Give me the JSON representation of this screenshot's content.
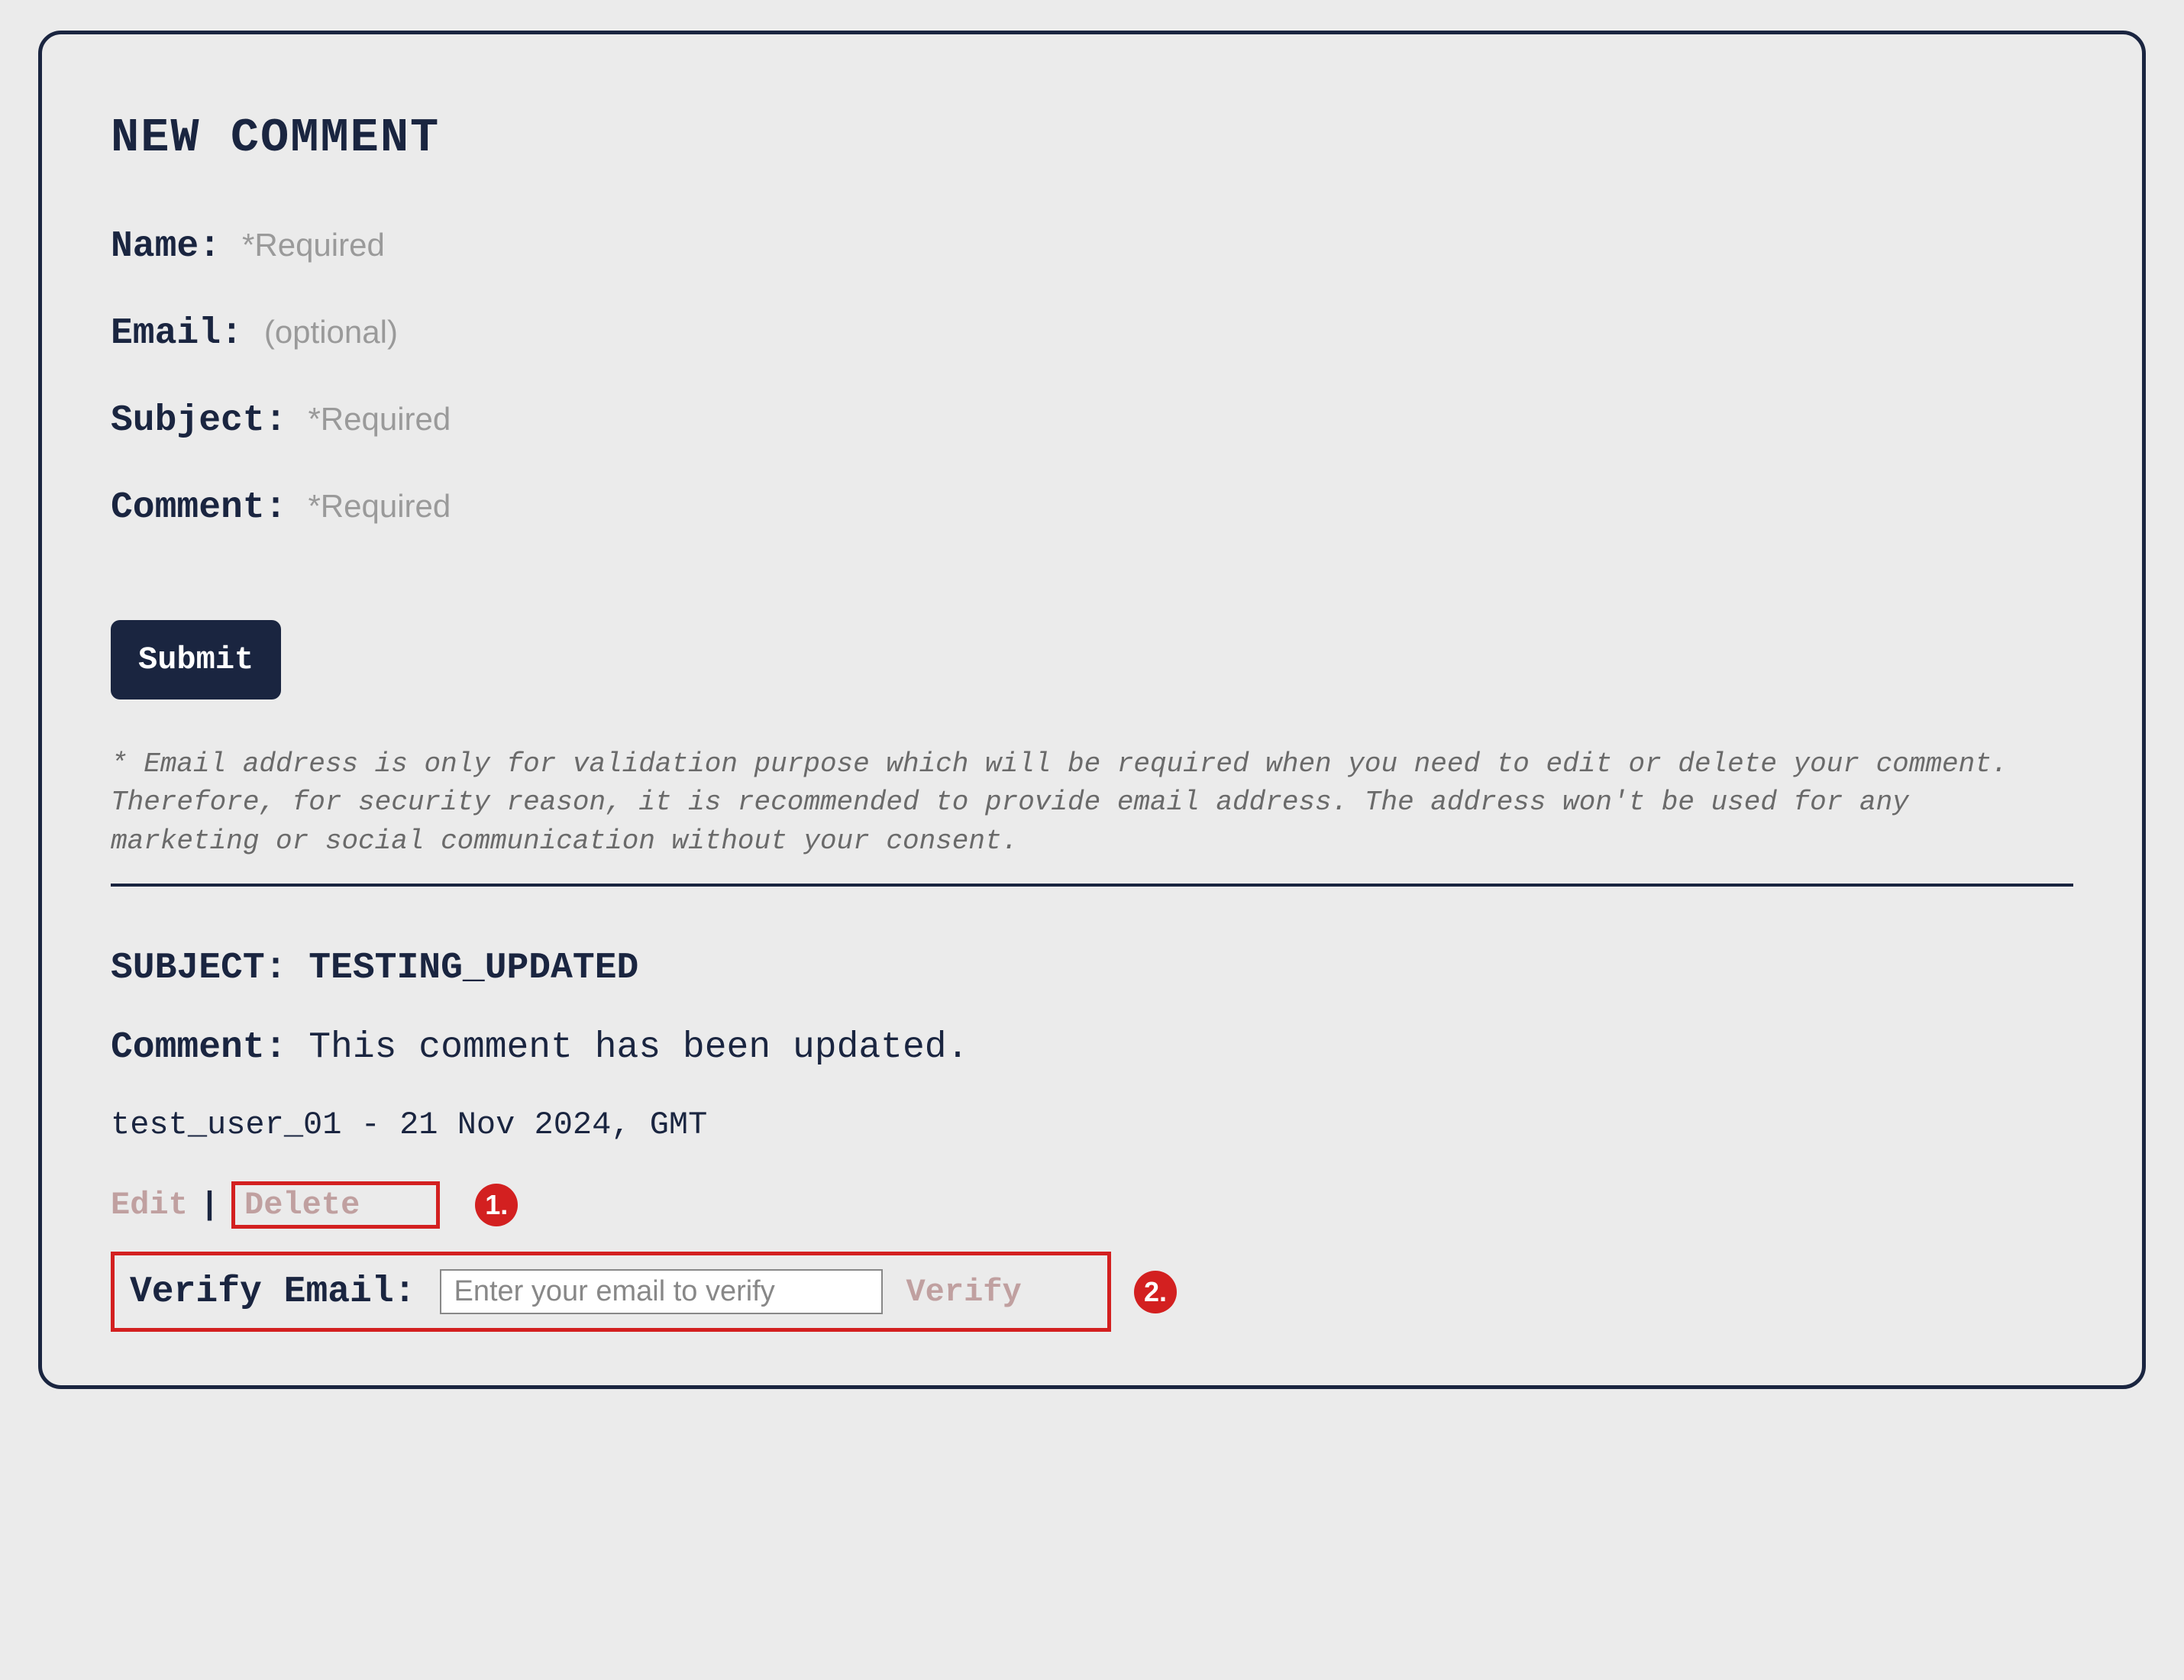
{
  "form": {
    "heading": "NEW COMMENT",
    "fields": {
      "name": {
        "label": "Name:",
        "hint": "*Required"
      },
      "email": {
        "label": "Email:",
        "hint": "(optional)"
      },
      "subject": {
        "label": "Subject:",
        "hint": "*Required"
      },
      "comment": {
        "label": "Comment:",
        "hint": "*Required"
      }
    },
    "submit_label": "Submit",
    "footnote": "* Email address is only for validation purpose which will be required when you need to edit or delete your comment. Therefore, for security reason, it is recommended to provide email address. The address won't be used for any marketing or social communication without your consent."
  },
  "post": {
    "subject_label": "SUBJECT:",
    "subject_value": "TESTING_UPDATED",
    "comment_label": "Comment:",
    "comment_body": "This comment has been updated.",
    "author": "test_user_01",
    "separator": " - ",
    "date": "21 Nov 2024, GMT",
    "actions": {
      "edit_label": "Edit",
      "pipe": "|",
      "delete_label": "Delete"
    },
    "verify": {
      "label": "Verify Email:",
      "placeholder": "Enter your email to verify",
      "button_label": "Verify"
    }
  },
  "callouts": {
    "one": "1.",
    "two": "2."
  }
}
